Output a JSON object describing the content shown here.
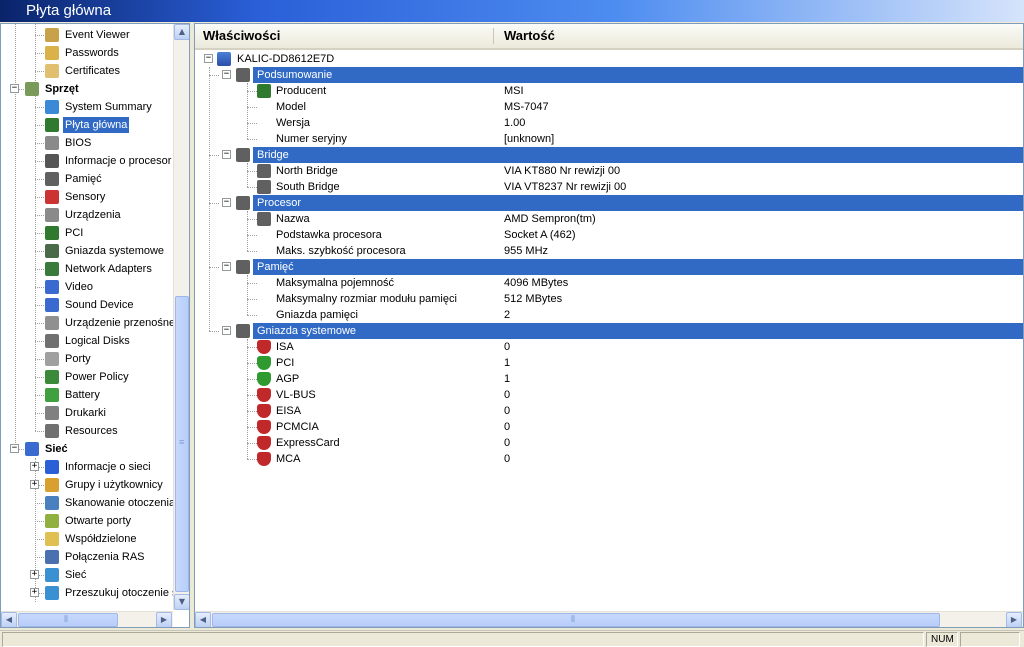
{
  "window": {
    "title": "Płyta główna"
  },
  "tree": [
    {
      "label": "Event Viewer",
      "level": 2,
      "icon": "event-viewer-icon",
      "color": "#c8a24a"
    },
    {
      "label": "Passwords",
      "level": 2,
      "icon": "key-icon",
      "color": "#d9b24a"
    },
    {
      "label": "Certificates",
      "level": 2,
      "icon": "certificate-icon",
      "color": "#e0c070"
    },
    {
      "label": "Sprzęt",
      "level": 1,
      "icon": "hardware-icon",
      "color": "#7a9a5a",
      "bold": true,
      "expander": "−"
    },
    {
      "label": "System Summary",
      "level": 2,
      "icon": "system-summary-icon",
      "color": "#3a8ad8"
    },
    {
      "label": "Płyta główna",
      "level": 2,
      "icon": "motherboard-icon",
      "color": "#2f7a2f",
      "selected": true
    },
    {
      "label": "BIOS",
      "level": 2,
      "icon": "chip-icon",
      "color": "#8a8a8a"
    },
    {
      "label": "Informacje o procesor",
      "level": 2,
      "icon": "processor-icon",
      "color": "#555555"
    },
    {
      "label": "Pamięć",
      "level": 2,
      "icon": "memory-icon",
      "color": "#606060"
    },
    {
      "label": "Sensory",
      "level": 2,
      "icon": "thermometer-icon",
      "color": "#cc3333"
    },
    {
      "label": "Urządzenia",
      "level": 2,
      "icon": "devices-icon",
      "color": "#8a8a8a"
    },
    {
      "label": "PCI",
      "level": 2,
      "icon": "pci-card-icon",
      "color": "#2f7a2f"
    },
    {
      "label": "Gniazda systemowe",
      "level": 2,
      "icon": "slots-icon",
      "color": "#4a6a4a"
    },
    {
      "label": "Network Adapters",
      "level": 2,
      "icon": "network-adapter-icon",
      "color": "#3a7a3a"
    },
    {
      "label": "Video",
      "level": 2,
      "icon": "monitor-icon",
      "color": "#3a6ad0"
    },
    {
      "label": "Sound Device",
      "level": 2,
      "icon": "music-note-icon",
      "color": "#3a6ad0"
    },
    {
      "label": "Urządzenie przenośne",
      "level": 2,
      "icon": "portable-device-icon",
      "color": "#909090"
    },
    {
      "label": "Logical Disks",
      "level": 2,
      "icon": "disk-icon",
      "color": "#707070"
    },
    {
      "label": "Porty",
      "level": 2,
      "icon": "port-icon",
      "color": "#a0a0a0"
    },
    {
      "label": "Power Policy",
      "level": 2,
      "icon": "power-policy-icon",
      "color": "#3a8a3a"
    },
    {
      "label": "Battery",
      "level": 2,
      "icon": "battery-icon",
      "color": "#40a040"
    },
    {
      "label": "Drukarki",
      "level": 2,
      "icon": "printer-icon",
      "color": "#808080"
    },
    {
      "label": "Resources",
      "level": 2,
      "icon": "resources-icon",
      "color": "#707070"
    },
    {
      "label": "Sieć",
      "level": 1,
      "icon": "network-icon",
      "color": "#3a6ad0",
      "bold": true,
      "expander": "−"
    },
    {
      "label": "Informacje o sieci",
      "level": 2,
      "icon": "info-icon",
      "color": "#2a5fd8",
      "expander": "+"
    },
    {
      "label": "Grupy i użytkownicy",
      "level": 2,
      "icon": "users-icon",
      "color": "#d8a030",
      "expander": "+"
    },
    {
      "label": "Skanowanie otoczenia",
      "level": 2,
      "icon": "scan-icon",
      "color": "#4a80c0"
    },
    {
      "label": "Otwarte porty",
      "level": 2,
      "icon": "open-ports-icon",
      "color": "#90b040"
    },
    {
      "label": "Współdzielone",
      "level": 2,
      "icon": "shared-folder-icon",
      "color": "#e0c050"
    },
    {
      "label": "Połączenia RAS",
      "level": 2,
      "icon": "ras-icon",
      "color": "#4a70b0"
    },
    {
      "label": "Sieć",
      "level": 2,
      "icon": "globe-icon",
      "color": "#3a90d0",
      "expander": "+"
    },
    {
      "label": "Przeszukuj otoczenie s",
      "level": 2,
      "icon": "search-network-icon",
      "color": "#3a90d0",
      "expander": "+"
    }
  ],
  "columns": {
    "property": "Właściwości",
    "value": "Wartość"
  },
  "root": {
    "label": "KALIC-DD8612E7D",
    "icon": "computer-icon"
  },
  "sections": [
    {
      "label": "Podsumowanie",
      "icon": "computer-icon",
      "rows": [
        {
          "label": "Producent",
          "value": "MSI",
          "icon": "motherboard-icon"
        },
        {
          "label": "Model",
          "value": "MS-7047"
        },
        {
          "label": "Wersja",
          "value": "1.00"
        },
        {
          "label": "Numer seryjny",
          "value": "[unknown]"
        }
      ]
    },
    {
      "label": "Bridge",
      "icon": "chip-icon",
      "rows": [
        {
          "label": "North Bridge",
          "value": "VIA KT880 Nr rewizji 00",
          "icon": "chip-icon"
        },
        {
          "label": "South Bridge",
          "value": "VIA VT8237 Nr rewizji 00",
          "icon": "chip-icon"
        }
      ]
    },
    {
      "label": "Procesor",
      "icon": "processor-icon",
      "rows": [
        {
          "label": "Nazwa",
          "value": "AMD Sempron(tm)",
          "icon": "processor-icon"
        },
        {
          "label": "Podstawka procesora",
          "value": "Socket A (462)"
        },
        {
          "label": "Maks. szybkość procesora",
          "value": "955 MHz"
        }
      ]
    },
    {
      "label": "Pamięć",
      "icon": "memory-icon",
      "rows": [
        {
          "label": "Maksymalna pojemność",
          "value": "4096 MBytes"
        },
        {
          "label": "Maksymalny rozmiar modułu pamięci",
          "value": "512 MBytes"
        },
        {
          "label": "Gniazda pamięci",
          "value": "2"
        }
      ]
    },
    {
      "label": "Gniazda systemowe",
      "icon": "slots-icon",
      "rows": [
        {
          "label": "ISA",
          "value": "0",
          "icon": "shield-red-icon"
        },
        {
          "label": "PCI",
          "value": "1",
          "icon": "shield-green-icon"
        },
        {
          "label": "AGP",
          "value": "1",
          "icon": "shield-green-icon"
        },
        {
          "label": "VL-BUS",
          "value": "0",
          "icon": "shield-red-icon"
        },
        {
          "label": "EISA",
          "value": "0",
          "icon": "shield-red-icon"
        },
        {
          "label": "PCMCIA",
          "value": "0",
          "icon": "shield-red-icon"
        },
        {
          "label": "ExpressCard",
          "value": "0",
          "icon": "shield-red-icon"
        },
        {
          "label": "MCA",
          "value": "0",
          "icon": "shield-red-icon"
        }
      ]
    }
  ],
  "status": {
    "num": "NUM"
  },
  "colors": {
    "selection": "#316ac5",
    "shield_red": "#c0282a",
    "shield_green": "#2f9a2f"
  }
}
